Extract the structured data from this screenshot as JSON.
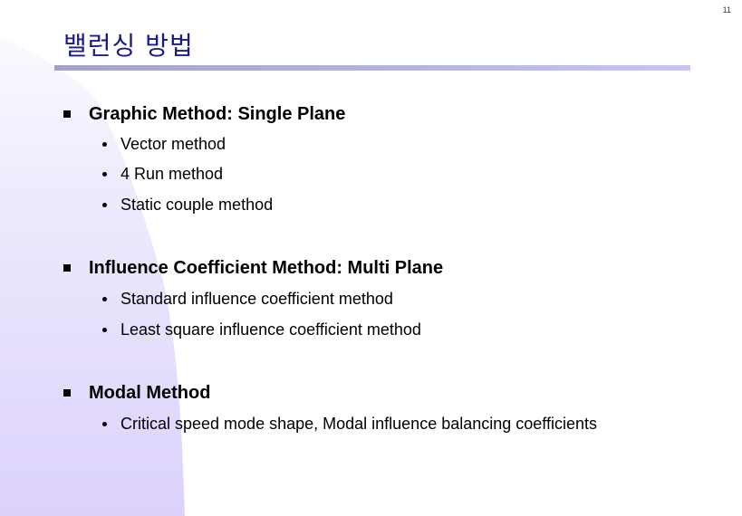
{
  "slide": {
    "page_number": "11",
    "title": "밸런싱 방법",
    "colors": {
      "title": "#1a1a8a",
      "title_bar_start": "#a3a3c9",
      "title_bar_end": "#c6c6f2",
      "background_shape_top": "#f4f2fe",
      "background_shape_bottom": "#dcd2fb"
    }
  },
  "sections": [
    {
      "heading": "Graphic Method: Single Plane",
      "items": [
        "Vector method",
        "4 Run method",
        "Static couple method"
      ]
    },
    {
      "heading": "Influence Coefficient Method: Multi Plane",
      "items": [
        "Standard influence coefficient method",
        "Least square influence coefficient method"
      ]
    },
    {
      "heading": "Modal Method",
      "items": [
        "Critical speed mode shape, Modal influence balancing coefficients"
      ]
    }
  ]
}
